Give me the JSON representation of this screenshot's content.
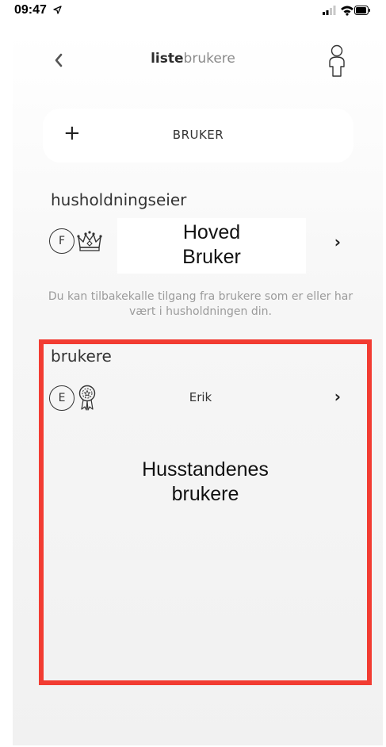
{
  "status_bar": {
    "time": "09:47",
    "icons": [
      "location-arrow-icon",
      "cellular-signal-icon",
      "wifi-icon",
      "battery-icon"
    ]
  },
  "nav": {
    "title_strong": "liste",
    "title_light": "brukere",
    "back_icon": "chevron-left-icon",
    "profile_icon": "person-outline-icon"
  },
  "add_user": {
    "plus": "+",
    "label": "BRUKER"
  },
  "owner_section": {
    "heading": "husholdningseier",
    "row": {
      "initial": "F",
      "role_icon": "crown-icon",
      "label_line1": "Hoved",
      "label_line2": "Bruker",
      "chevron": "›"
    }
  },
  "info_text": "Du kan tilbakekalle tilgang fra brukere som er eller har vært i husholdningen din.",
  "users_section": {
    "heading": "brukere",
    "users": [
      {
        "initial": "E",
        "role_icon": "badge-icon",
        "name": "Erik",
        "chevron": "›"
      }
    ],
    "caption_line1": "Husstandenes",
    "caption_line2": "brukere"
  },
  "colors": {
    "highlight_border": "#f23c32",
    "card_bg": "#ffffff",
    "muted_text": "#9b9b9b"
  }
}
